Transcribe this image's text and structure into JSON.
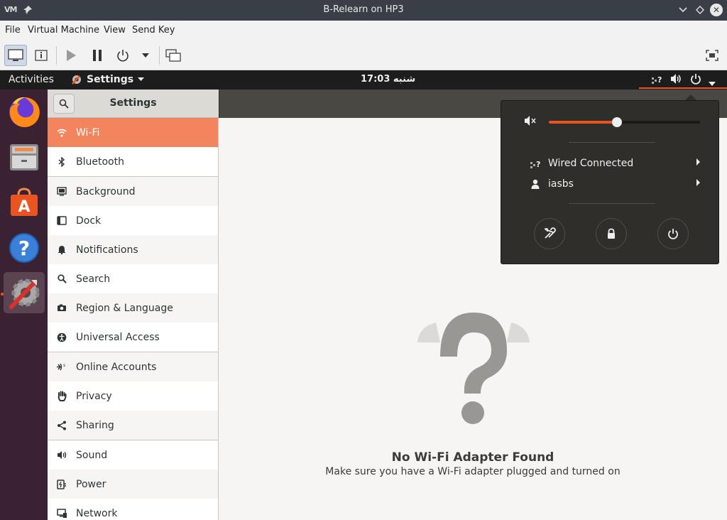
{
  "host": {
    "logo": "VM",
    "window_title": "B-Relearn on HP3",
    "menu": [
      "File",
      "Virtual Machine",
      "View",
      "Send Key"
    ]
  },
  "topbar": {
    "activities": "Activities",
    "app_menu": "Settings",
    "clock": "شنبه 17:03"
  },
  "settings": {
    "title": "Settings",
    "sidebar": [
      {
        "label": "Wi-Fi",
        "icon": "wifi-icon"
      },
      {
        "label": "Bluetooth",
        "icon": "bluetooth-icon"
      },
      {
        "label": "Background",
        "icon": "background-icon"
      },
      {
        "label": "Dock",
        "icon": "dock-icon"
      },
      {
        "label": "Notifications",
        "icon": "bell-icon"
      },
      {
        "label": "Search",
        "icon": "search-icon"
      },
      {
        "label": "Region & Language",
        "icon": "camera-icon"
      },
      {
        "label": "Universal Access",
        "icon": "accessibility-icon"
      },
      {
        "label": "Online Accounts",
        "icon": "online-accounts-icon"
      },
      {
        "label": "Privacy",
        "icon": "hand-icon"
      },
      {
        "label": "Sharing",
        "icon": "share-icon"
      },
      {
        "label": "Sound",
        "icon": "speaker-icon"
      },
      {
        "label": "Power",
        "icon": "plug-icon"
      },
      {
        "label": "Network",
        "icon": "network-icon"
      }
    ],
    "selected": "Wi-Fi",
    "content": {
      "title": "No Wi-Fi Adapter Found",
      "subtitle": "Make sure you have a Wi-Fi adapter plugged and turned on"
    }
  },
  "system_menu": {
    "volume": 0.45,
    "wired": "Wired Connected",
    "user": "iasbs",
    "buttons": [
      "settings-button",
      "lock-button",
      "power-off-button"
    ]
  },
  "colors": {
    "accent": "#e95420",
    "selection": "#f2845e",
    "dock_bg": "#3a2233",
    "topbar_bg": "#1d1d1d"
  }
}
